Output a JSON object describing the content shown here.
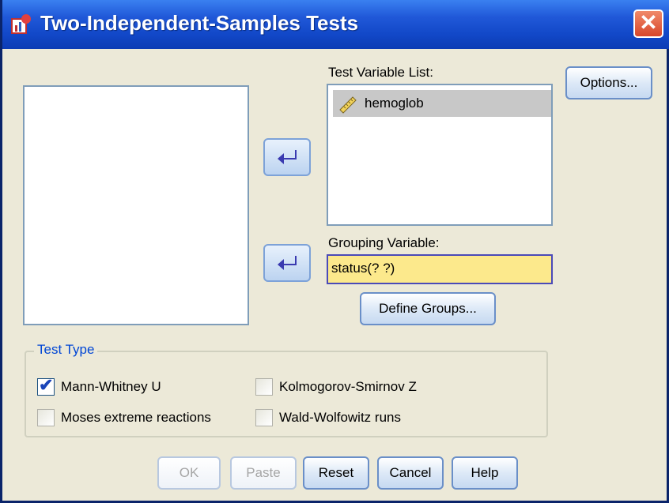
{
  "window": {
    "title": "Two-Independent-Samples Tests",
    "close_glyph": "✕"
  },
  "test_variable_list": {
    "label": "Test Variable List:",
    "items": [
      {
        "label": "hemoglob",
        "icon": "scale-ruler-icon"
      }
    ]
  },
  "grouping_variable": {
    "label": "Grouping Variable:",
    "value": "status(? ?)"
  },
  "buttons": {
    "options": "Options...",
    "define_groups": "Define Groups...",
    "ok": "OK",
    "paste": "Paste",
    "reset": "Reset",
    "cancel": "Cancel",
    "help": "Help"
  },
  "test_type": {
    "legend": "Test Type",
    "options": [
      {
        "label": "Mann-Whitney U",
        "checked": true
      },
      {
        "label": "Kolmogorov-Smirnov Z",
        "checked": false
      },
      {
        "label": "Moses extreme reactions",
        "checked": false
      },
      {
        "label": "Wald-Wolfowitz runs",
        "checked": false
      }
    ]
  },
  "colors": {
    "title_bar": "#1248c8",
    "grouping_field_bg": "#fce98c",
    "legend_text": "#0046d5"
  }
}
